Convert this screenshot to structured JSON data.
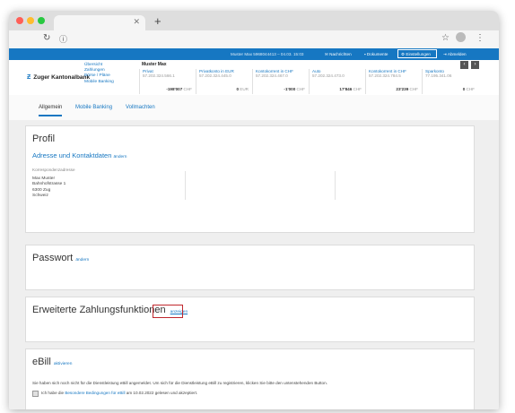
{
  "browser": {
    "new_tab_label": "+",
    "reload_icon": "reload-icon",
    "info_icon": "info-icon",
    "star_icon": "star-icon",
    "menu_icon": "kebab-menu-icon",
    "window_colors": {
      "close": "#ff5f57",
      "minimize": "#febc2e",
      "maximize": "#28c840"
    }
  },
  "topbar": {
    "user_info": "Muster Max  5968044413 – 04.03. 15:03",
    "messages": "Nachrichten",
    "documents": "Dokumente",
    "settings": "Einstellungen",
    "logout": "Abmelden",
    "color": "#1677c2"
  },
  "bank": {
    "name": "Zuger Kantonalbank",
    "logo_mark": "Ƶ"
  },
  "nav": {
    "items": [
      "Übersicht",
      "Zahlungen",
      "Börse / Pläne",
      "Mobile Banking"
    ]
  },
  "user": {
    "name": "Muster Max"
  },
  "accounts": [
    {
      "name": "Privat",
      "iban": "57.202.324.566.1",
      "balance": "-198'007",
      "currency": "CHF"
    },
    {
      "name": "Privatkonto in EUR",
      "iban": "57.202.324.445.0",
      "balance": "0",
      "currency": "EUR"
    },
    {
      "name": "Kontokorrent in CHF",
      "iban": "57.202.324.467.0",
      "balance": "-1'000",
      "currency": "CHF"
    },
    {
      "name": "Auto",
      "iban": "57.202.324.473.0",
      "balance": "17'846",
      "currency": "CHF"
    },
    {
      "name": "Kontokorrent in CHF",
      "iban": "57.202.324.784.5",
      "balance": "23'239",
      "currency": "CHF"
    },
    {
      "name": "Sparkonto",
      "iban": "77.195.341.06",
      "balance": "0",
      "currency": "CHF"
    }
  ],
  "carousel": {
    "prev": "‹",
    "next": "›"
  },
  "tabs": {
    "general": "Allgemein",
    "mobile": "Mobile Banking",
    "powers": "Vollmachten"
  },
  "profile": {
    "title": "Profil",
    "section": "Adresse und Kontaktdaten",
    "change": "ändern",
    "corr_label": "Korrespondenzadresse",
    "address_lines": [
      "Max Muster",
      "Bahnhofstrasse 1",
      "6300 Zug",
      "Schweiz"
    ]
  },
  "password": {
    "title": "Passwort",
    "change": "ändern"
  },
  "payment": {
    "title": "Erweiterte Zahlungsfunktionen",
    "show": "anzeigen"
  },
  "ebill": {
    "title": "eBill",
    "activate": "aktivieren",
    "info": "Sie haben sich noch nicht für die Dienstleistung eBill angemeldet. Um sich für die Dienstleistung eBill zu registrieren, klicken Sie bitte den untenstehenden Button.",
    "checkbox_prefix": "Ich habe die",
    "checkbox_link": "Besondere Bedingungen für eBill",
    "checkbox_suffix": "am 10.02.2022 gelesen und akzeptiert."
  }
}
